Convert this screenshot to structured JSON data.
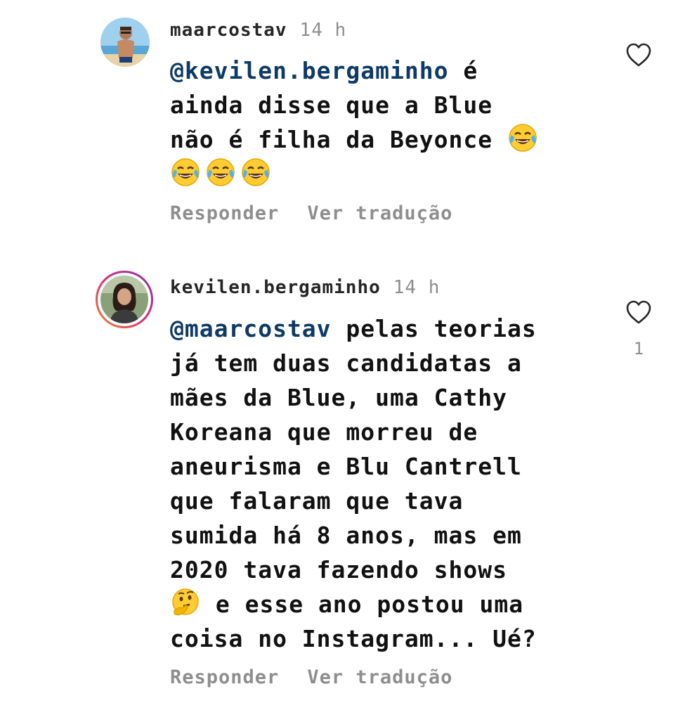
{
  "comments": [
    {
      "username": "maarcostav",
      "time": "14 h",
      "mention": "@kevilen.bergaminho",
      "lines": [
        " é",
        "ainda disse que a Blue",
        "não é filha da Beyonce "
      ],
      "emoji_icon": "laughing-tears-emoji",
      "reply_label": "Responder",
      "translate_label": "Ver tradução",
      "like_icon": "heart-outline-icon"
    },
    {
      "username": "kevilen.bergaminho",
      "time": "14 h",
      "mention": "@maarcostav",
      "lines": [
        " pelas teorias",
        "já tem duas candidatas a",
        "mães da Blue, uma Cathy",
        "Koreana que morreu de",
        "aneurisma e Blu Cantrell",
        "que falaram que tava",
        "sumida há 8 anos, mas em",
        "2020 tava fazendo shows",
        " e esse ano postou uma",
        "coisa no Instagram... Ué?"
      ],
      "emoji_icon": "thinking-face-emoji",
      "reply_label": "Responder",
      "translate_label": "Ver tradução",
      "like_icon": "heart-outline-icon",
      "like_count": "1"
    }
  ],
  "colors": {
    "mention": "#0d3a66",
    "muted": "#8e8e8e",
    "story_ring_start": "#f58529",
    "story_ring_end": "#c13584"
  }
}
